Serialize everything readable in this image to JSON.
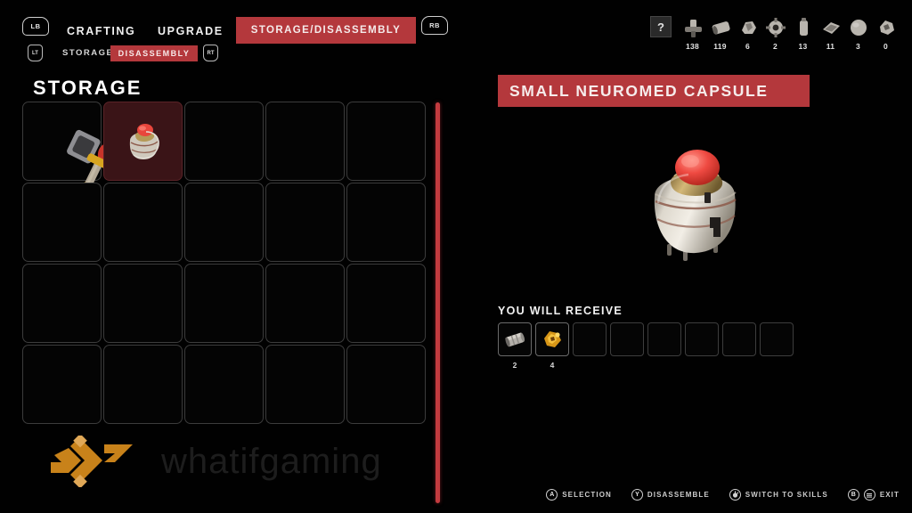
{
  "nav": {
    "bumper_left": "LB",
    "bumper_right": "RB",
    "trigger_left": "LT",
    "trigger_right": "RT",
    "main_tabs": [
      {
        "label": "CRAFTING",
        "active": false
      },
      {
        "label": "UPGRADE",
        "active": false
      },
      {
        "label": "STORAGE/DISASSEMBLY",
        "active": true
      }
    ],
    "sub_tabs": [
      {
        "label": "STORAGE",
        "active": false
      },
      {
        "label": "DISASSEMBLY",
        "active": true
      }
    ]
  },
  "resources": {
    "help_label": "?",
    "items": [
      {
        "icon": "bolt-resource-icon",
        "count": "138"
      },
      {
        "icon": "cylinder-resource-icon",
        "count": "119"
      },
      {
        "icon": "scrap-resource-icon",
        "count": "6"
      },
      {
        "icon": "gear-resource-icon",
        "count": "2"
      },
      {
        "icon": "canister-resource-icon",
        "count": "13"
      },
      {
        "icon": "plate-resource-icon",
        "count": "11"
      },
      {
        "icon": "sphere-resource-icon",
        "count": "3"
      },
      {
        "icon": "cluster-resource-icon",
        "count": "0"
      }
    ]
  },
  "storage": {
    "title": "STORAGE",
    "columns": 5,
    "rows": 4,
    "cells": [
      {
        "index": 0,
        "item": "pickaxe-weapon",
        "selected": false
      },
      {
        "index": 1,
        "item": "neuromed-capsule",
        "selected": true
      },
      {
        "index": 2,
        "item": null,
        "selected": false
      },
      {
        "index": 3,
        "item": null,
        "selected": false
      },
      {
        "index": 4,
        "item": null,
        "selected": false
      },
      {
        "index": 5,
        "item": null,
        "selected": false
      },
      {
        "index": 6,
        "item": null,
        "selected": false
      },
      {
        "index": 7,
        "item": null,
        "selected": false
      },
      {
        "index": 8,
        "item": null,
        "selected": false
      },
      {
        "index": 9,
        "item": null,
        "selected": false
      },
      {
        "index": 10,
        "item": null,
        "selected": false
      },
      {
        "index": 11,
        "item": null,
        "selected": false
      },
      {
        "index": 12,
        "item": null,
        "selected": false
      },
      {
        "index": 13,
        "item": null,
        "selected": false
      },
      {
        "index": 14,
        "item": null,
        "selected": false
      },
      {
        "index": 15,
        "item": null,
        "selected": false
      },
      {
        "index": 16,
        "item": null,
        "selected": false
      },
      {
        "index": 17,
        "item": null,
        "selected": false
      },
      {
        "index": 18,
        "item": null,
        "selected": false
      },
      {
        "index": 19,
        "item": null,
        "selected": false
      }
    ]
  },
  "detail": {
    "item_name": "SMALL NEUROMED CAPSULE",
    "preview_icon": "neuromed-capsule-model",
    "receive_label": "YOU WILL RECEIVE",
    "receive_slots": [
      {
        "icon": "metal-cylinder-icon",
        "count": "2"
      },
      {
        "icon": "gold-cluster-icon",
        "count": "4"
      },
      {
        "icon": null,
        "count": ""
      },
      {
        "icon": null,
        "count": ""
      },
      {
        "icon": null,
        "count": ""
      },
      {
        "icon": null,
        "count": ""
      },
      {
        "icon": null,
        "count": ""
      },
      {
        "icon": null,
        "count": ""
      }
    ]
  },
  "hints": [
    {
      "glyph": "A",
      "label": "SELECTION"
    },
    {
      "glyph": "Y",
      "label": "DISASSEMBLE"
    },
    {
      "glyph": "stick",
      "label": "SWITCH TO SKILLS"
    },
    {
      "glyph": "B",
      "label": "EXIT"
    }
  ],
  "watermark": {
    "text": "whatifgaming",
    "logo_color": "#c8821a"
  },
  "colors": {
    "accent_red": "#b4383c",
    "scrollbar_red": "#c33b3f",
    "selected_cell": "#3a1417"
  }
}
